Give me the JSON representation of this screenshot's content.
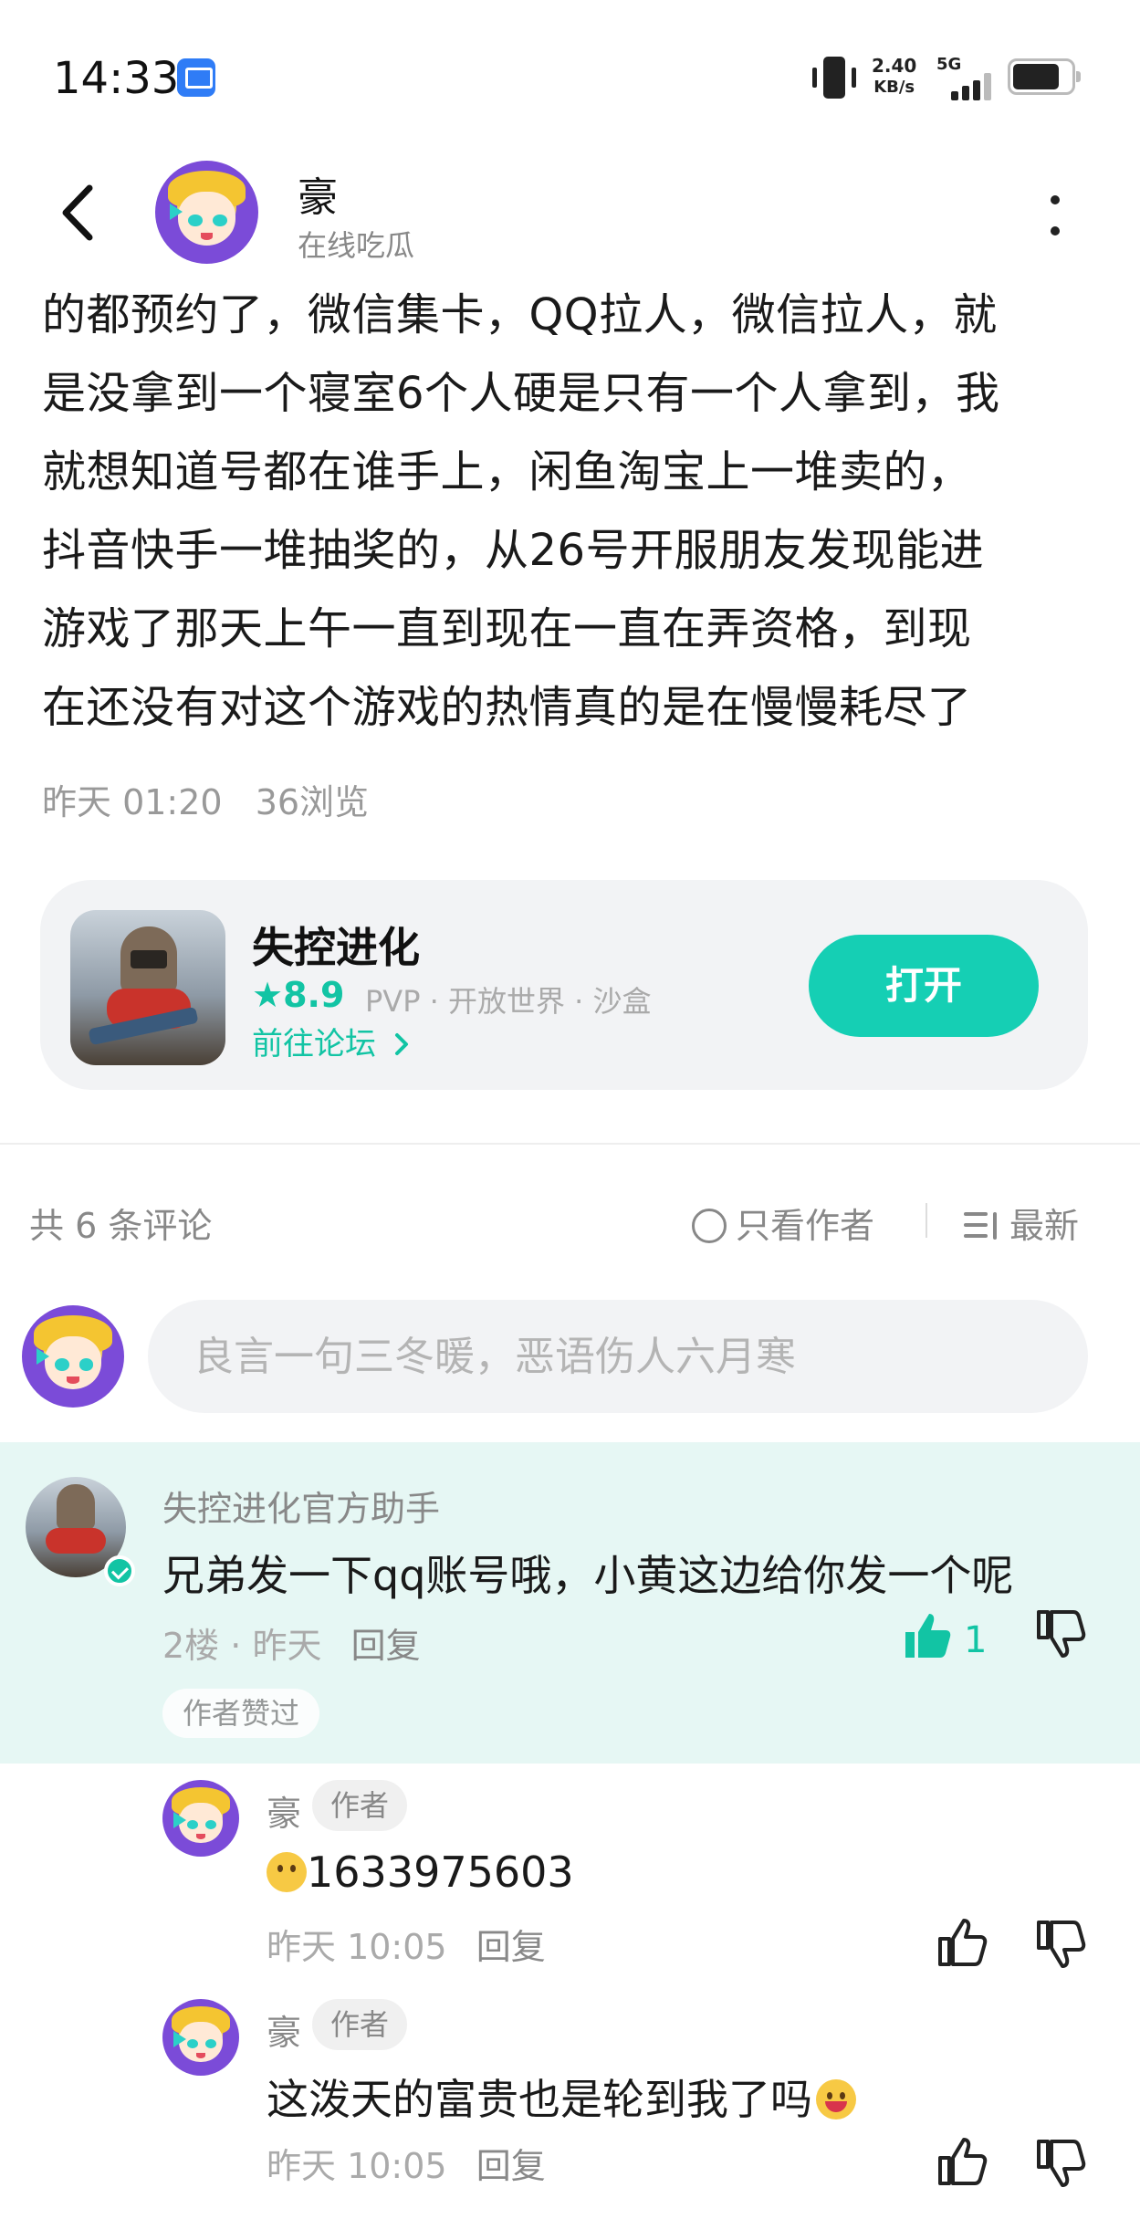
{
  "status_bar": {
    "time": "14:33",
    "net_speed": "2.40",
    "net_unit": "KB/s",
    "network": "5G",
    "notification_icon": "screen-share-icon",
    "vibrate_icon": "vibrate-icon",
    "battery_level": 0.8
  },
  "header": {
    "name": "豪",
    "status": "在线吃瓜",
    "back_icon": "back-arrow-icon",
    "more_icon": "more-vertical-icon"
  },
  "post": {
    "lines": [
      "的都预约了，微信集卡，QQ拉人，微信拉人，就",
      "是没拿到一个寝室6个人硬是只有一个人拿到，我",
      "就想知道号都在谁手上，闲鱼淘宝上一堆卖的，",
      "抖音快手一堆抽奖的，从26号开服朋友发现能进",
      "游戏了那天上午一直到现在一直在弄资格，到现",
      "在还没有对这个游戏的热情真的是在慢慢耗尽了"
    ],
    "time": "昨天 01:20",
    "views": "36浏览"
  },
  "game_card": {
    "title": "失控进化",
    "rating": "8.9",
    "tags": "PVP · 开放世界 · 沙盒",
    "forum_link": "前往论坛",
    "open_label": "打开",
    "accent_color": "#15cfb4"
  },
  "comments_header": {
    "count_label": "共 6 条评论",
    "author_only_label": "只看作者",
    "sort_label": "最新"
  },
  "reply_box": {
    "placeholder": "良言一句三冬暖，恶语伤人六月寒"
  },
  "main_comment": {
    "name": "失控进化官方助手",
    "text": "兄弟发一下qq账号哦，小黄这边给你发一个呢",
    "floor": "2楼",
    "time": "昨天",
    "reply_label": "回复",
    "like_count": "1",
    "author_liked": "作者赞过"
  },
  "replies": [
    {
      "name": "豪",
      "tag": "作者",
      "text": "1633975603",
      "time": "昨天 10:05",
      "reply_label": "回复"
    },
    {
      "name": "豪",
      "tag": "作者",
      "text": "这泼天的富贵也是轮到我了吗",
      "time": "昨天 10:05",
      "reply_label": "回复"
    }
  ]
}
